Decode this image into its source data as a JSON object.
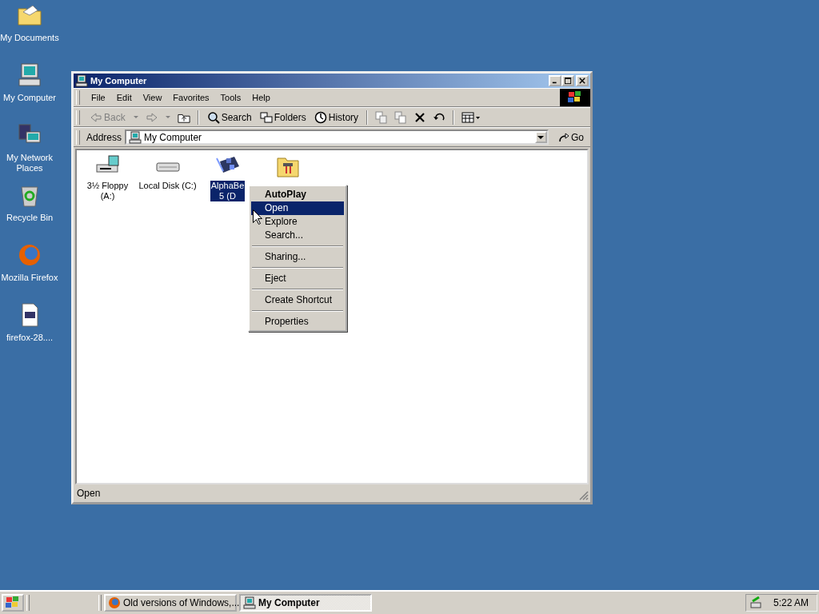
{
  "desktop_icons": [
    {
      "lines": [
        "My Documents"
      ]
    },
    {
      "lines": [
        "My Computer"
      ]
    },
    {
      "lines": [
        "My Network",
        "Places"
      ]
    },
    {
      "lines": [
        "Recycle Bin"
      ]
    },
    {
      "lines": [
        "Mozilla Firefox"
      ]
    },
    {
      "lines": [
        "firefox-28...."
      ]
    }
  ],
  "window": {
    "title": "My Computer",
    "menu": [
      "File",
      "Edit",
      "View",
      "Favorites",
      "Tools",
      "Help"
    ],
    "toolbar": [
      {
        "label": "Back",
        "disabled": true
      },
      {
        "label": "Search",
        "disabled": false
      },
      {
        "label": "Folders",
        "disabled": false
      },
      {
        "label": "History",
        "disabled": false
      }
    ],
    "address": {
      "label": "Address",
      "value": "My Computer",
      "go": "Go"
    },
    "items": [
      {
        "kind": "floppy",
        "lines": [
          "3½ Floppy",
          "(A:)"
        ],
        "selected": false
      },
      {
        "kind": "disk",
        "lines": [
          "Local Disk (C:)"
        ],
        "selected": false
      },
      {
        "kind": "cd",
        "lines": [
          "AlphaBe",
          "5 (D"
        ],
        "selected": true
      },
      {
        "kind": "folder"
      }
    ],
    "status_bar": "Open"
  },
  "context_menu": [
    {
      "kind": "item",
      "label": "AutoPlay",
      "default": true,
      "selected": false
    },
    {
      "kind": "item",
      "label": "Open",
      "default": false,
      "selected": true
    },
    {
      "kind": "item",
      "label": "Explore",
      "default": false,
      "selected": false
    },
    {
      "kind": "item",
      "label": "Search...",
      "default": false,
      "selected": false
    },
    {
      "kind": "separator"
    },
    {
      "kind": "item",
      "label": "Sharing...",
      "default": false,
      "selected": false
    },
    {
      "kind": "separator"
    },
    {
      "kind": "item",
      "label": "Eject",
      "default": false,
      "selected": false
    },
    {
      "kind": "separator"
    },
    {
      "kind": "item",
      "label": "Create Shortcut",
      "default": false,
      "selected": false
    },
    {
      "kind": "separator"
    },
    {
      "kind": "item",
      "label": "Properties",
      "default": false,
      "selected": false
    }
  ],
  "taskbar": {
    "tasks": [
      {
        "label": "Old versions of Windows,...",
        "selected": false
      },
      {
        "label": "My Computer",
        "selected": true
      }
    ],
    "clock": "5:22 AM"
  }
}
